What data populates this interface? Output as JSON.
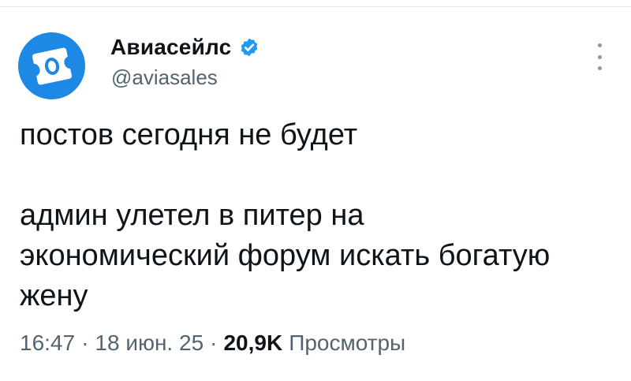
{
  "account": {
    "display_name": "Авиасейлс",
    "handle": "@aviasales",
    "verified": true,
    "avatar_icon": "aviasales-logo-icon",
    "avatar_color": "#1e88e5",
    "verified_color": "#1d9bf0"
  },
  "tweet": {
    "line_1": "постов сегодня не будет",
    "line_2": "админ улетел в питер на",
    "line_3": "экономический форум искать богатую",
    "line_4": "жену"
  },
  "meta": {
    "time": "16:47",
    "separator": "·",
    "date": "18 июн. 25",
    "views_count": "20,9K",
    "views_label": "Просмотры"
  },
  "icons": {
    "more": "more-vertical-icon",
    "verified": "verified-badge-icon"
  }
}
